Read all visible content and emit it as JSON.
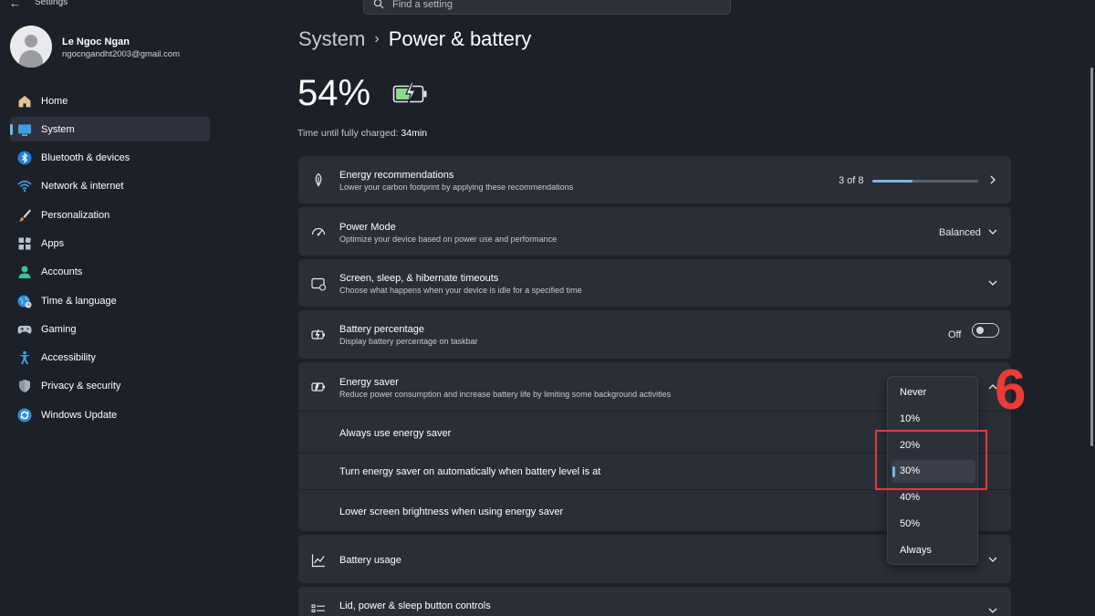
{
  "window": {
    "title": "Settings"
  },
  "search": {
    "placeholder": "Find a setting"
  },
  "user": {
    "name": "Le Ngoc Ngan",
    "email": "ngocngandht2003@gmail.com"
  },
  "sidebar": {
    "items": [
      {
        "label": "Home",
        "icon": "home-icon",
        "active": false
      },
      {
        "label": "System",
        "icon": "monitor-icon",
        "active": true
      },
      {
        "label": "Bluetooth & devices",
        "icon": "bluetooth-icon",
        "active": false
      },
      {
        "label": "Network & internet",
        "icon": "wifi-icon",
        "active": false
      },
      {
        "label": "Personalization",
        "icon": "brush-icon",
        "active": false
      },
      {
        "label": "Apps",
        "icon": "apps-icon",
        "active": false
      },
      {
        "label": "Accounts",
        "icon": "person-icon",
        "active": false
      },
      {
        "label": "Time & language",
        "icon": "globe-clock-icon",
        "active": false
      },
      {
        "label": "Gaming",
        "icon": "gamepad-icon",
        "active": false
      },
      {
        "label": "Accessibility",
        "icon": "accessibility-icon",
        "active": false
      },
      {
        "label": "Privacy & security",
        "icon": "shield-icon",
        "active": false
      },
      {
        "label": "Windows Update",
        "icon": "update-icon",
        "active": false
      }
    ]
  },
  "breadcrumb": {
    "parent": "System",
    "current": "Power & battery"
  },
  "battery": {
    "percent": "54%",
    "charge_label": "Time until fully charged:",
    "charge_time": "34min"
  },
  "cards": {
    "energy_rec": {
      "title": "Energy recommendations",
      "subtitle": "Lower your carbon footprint by applying these recommendations",
      "progress_text": "3 of 8",
      "progress_fraction": 0.375
    },
    "power_mode": {
      "title": "Power Mode",
      "subtitle": "Optimize your device based on power use and performance",
      "value": "Balanced"
    },
    "timeouts": {
      "title": "Screen, sleep, & hibernate timeouts",
      "subtitle": "Choose what happens when your device is idle for a specified time"
    },
    "battery_pct": {
      "title": "Battery percentage",
      "subtitle": "Display battery percentage on taskbar",
      "toggle_label": "Off"
    },
    "energy_saver": {
      "title": "Energy saver",
      "subtitle": "Reduce power consumption and increase battery life by limiting some background activities",
      "rows": [
        "Always use energy saver",
        "Turn energy saver on automatically when battery level is at",
        "Lower screen brightness when using energy saver"
      ]
    },
    "battery_usage": {
      "title": "Battery usage"
    },
    "lid": {
      "title": "Lid, power & sleep button controls"
    }
  },
  "dropdown": {
    "options": [
      "Never",
      "10%",
      "20%",
      "30%",
      "40%",
      "50%",
      "Always"
    ],
    "selected": "30%"
  },
  "annotation": {
    "step": "6",
    "color": "#e5383b"
  },
  "colors": {
    "accent": "#69c0f0",
    "background": "#1c2029",
    "card": "#2a2e37"
  }
}
